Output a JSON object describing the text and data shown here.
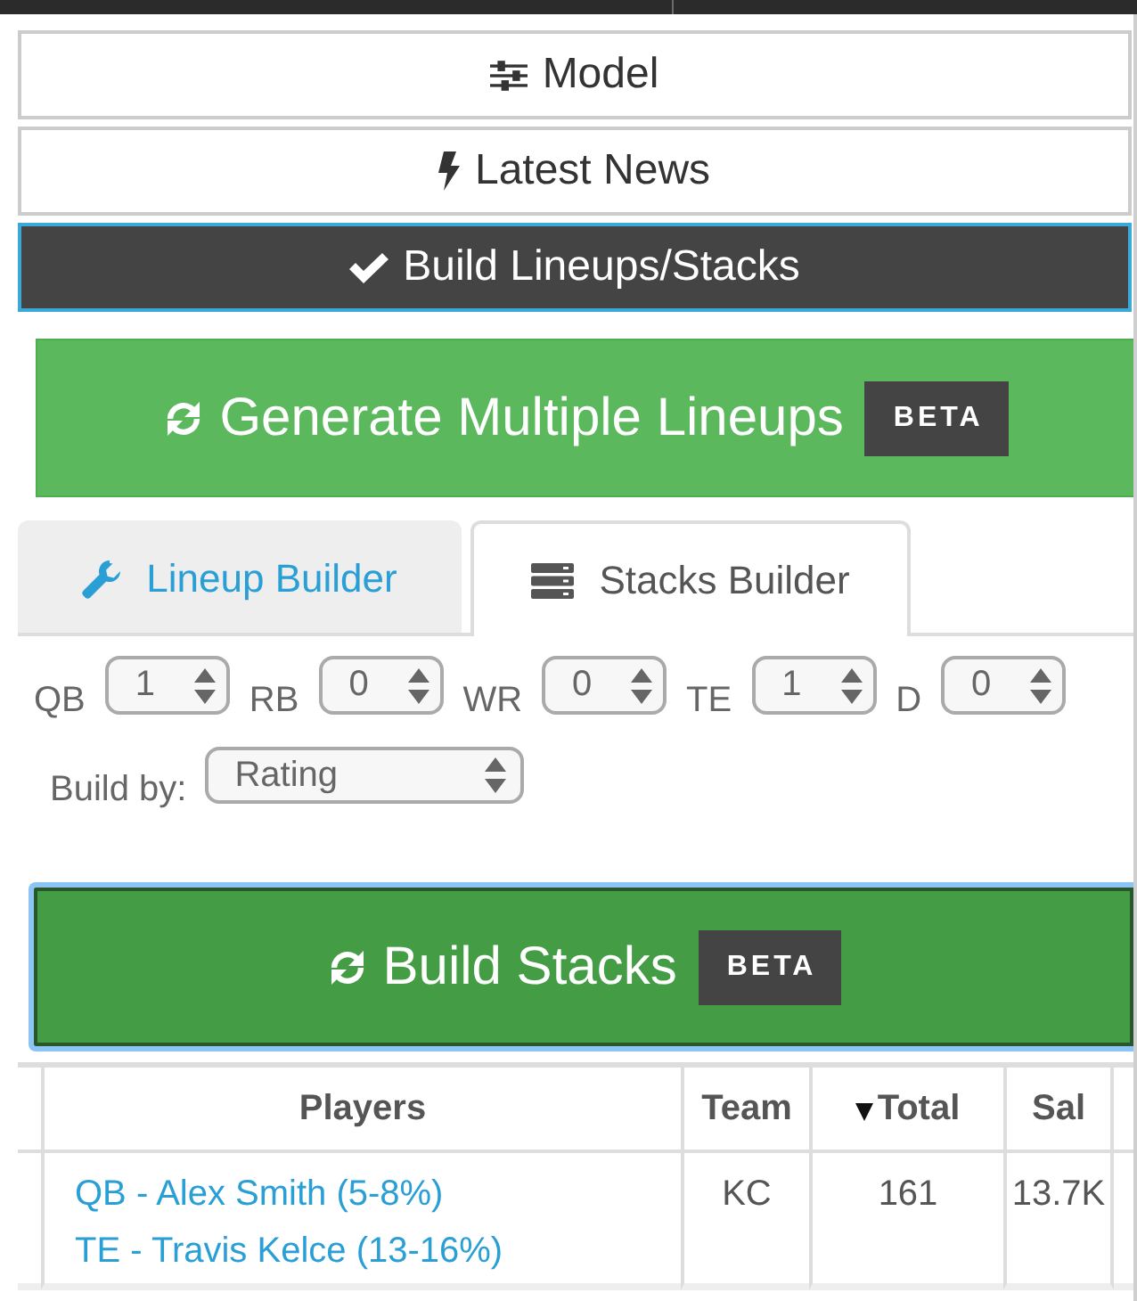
{
  "nav_buttons": [
    {
      "label": "Model",
      "selected": false
    },
    {
      "label": "Latest News",
      "selected": false
    },
    {
      "label": "Build Lineups/Stacks",
      "selected": true
    }
  ],
  "generate_button": {
    "label": "Generate Multiple Lineups",
    "badge": "BETA"
  },
  "tabs": [
    {
      "label": "Lineup Builder",
      "selected": false
    },
    {
      "label": "Stacks Builder",
      "selected": true
    }
  ],
  "position_counts": [
    {
      "label": "QB",
      "value": "1"
    },
    {
      "label": "RB",
      "value": "0"
    },
    {
      "label": "WR",
      "value": "0"
    },
    {
      "label": "TE",
      "value": "1"
    },
    {
      "label": "D",
      "value": "0"
    }
  ],
  "build_by": {
    "label": "Build by:",
    "value": "Rating"
  },
  "build_button": {
    "label": "Build Stacks",
    "badge": "BETA",
    "focused": true
  },
  "table": {
    "columns": [
      {
        "label": "Players",
        "sorted": false
      },
      {
        "label": "Team",
        "sorted": false
      },
      {
        "label": "Total",
        "sorted": true
      },
      {
        "label": "Sal",
        "sorted": false
      }
    ],
    "rows": [
      {
        "players": [
          "QB - Alex Smith (5-8%)",
          "TE - Travis Kelce (13-16%)"
        ],
        "team": "KC",
        "total": "161",
        "sal": "13.7K"
      }
    ]
  }
}
